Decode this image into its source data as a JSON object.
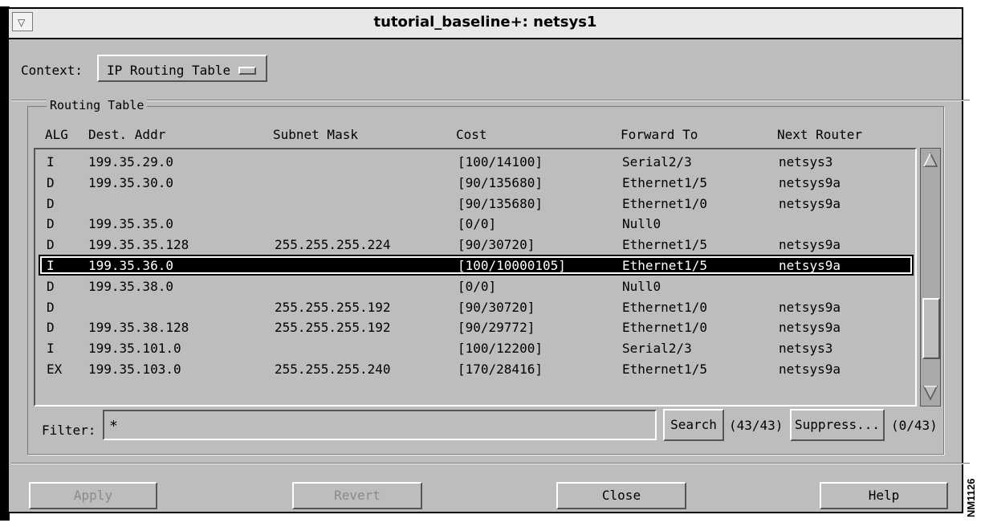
{
  "window": {
    "title": "tutorial_baseline+: netsys1",
    "menu_icon": "down-triangle-icon"
  },
  "context": {
    "label": "Context:",
    "selected": "IP Routing Table"
  },
  "routing_table": {
    "group_title": "Routing Table",
    "columns": [
      "ALG",
      "Dest. Addr",
      "Subnet Mask",
      "Cost",
      "Forward To",
      "Next Router"
    ],
    "rows": [
      {
        "alg": "I",
        "dest": "199.35.29.0",
        "mask": "",
        "cost": "[100/14100]",
        "fwd": "Serial2/3",
        "next": "netsys3"
      },
      {
        "alg": "D",
        "dest": "199.35.30.0",
        "mask": "",
        "cost": "[90/135680]",
        "fwd": "Ethernet1/5",
        "next": "netsys9a"
      },
      {
        "alg": "D",
        "dest": "",
        "mask": "",
        "cost": "[90/135680]",
        "fwd": "Ethernet1/0",
        "next": "netsys9a"
      },
      {
        "alg": "D",
        "dest": "199.35.35.0",
        "mask": "",
        "cost": "[0/0]",
        "fwd": "Null0",
        "next": ""
      },
      {
        "alg": "D",
        "dest": "199.35.35.128",
        "mask": "255.255.255.224",
        "cost": "[90/30720]",
        "fwd": "Ethernet1/5",
        "next": "netsys9a"
      },
      {
        "alg": "I",
        "dest": "199.35.36.0",
        "mask": "",
        "cost": "[100/10000105]",
        "fwd": "Ethernet1/5",
        "next": "netsys9a",
        "selected": true
      },
      {
        "alg": "D",
        "dest": "199.35.38.0",
        "mask": "",
        "cost": "[0/0]",
        "fwd": "Null0",
        "next": ""
      },
      {
        "alg": "D",
        "dest": "",
        "mask": "255.255.255.192",
        "cost": "[90/30720]",
        "fwd": "Ethernet1/0",
        "next": "netsys9a"
      },
      {
        "alg": "D",
        "dest": "199.35.38.128",
        "mask": "255.255.255.192",
        "cost": "[90/29772]",
        "fwd": "Ethernet1/0",
        "next": "netsys9a"
      },
      {
        "alg": "I",
        "dest": "199.35.101.0",
        "mask": "",
        "cost": "[100/12200]",
        "fwd": "Serial2/3",
        "next": "netsys3"
      },
      {
        "alg": "EX",
        "dest": "199.35.103.0",
        "mask": "255.255.255.240",
        "cost": "[170/28416]",
        "fwd": "Ethernet1/5",
        "next": "netsys9a"
      }
    ]
  },
  "filter": {
    "label": "Filter:",
    "value": "*",
    "search_label": "Search",
    "search_count": "(43/43)",
    "suppress_label": "Suppress...",
    "suppress_count": "(0/43)"
  },
  "buttons": {
    "apply": "Apply",
    "revert": "Revert",
    "close": "Close",
    "help": "Help"
  },
  "side_label": "NM1126"
}
